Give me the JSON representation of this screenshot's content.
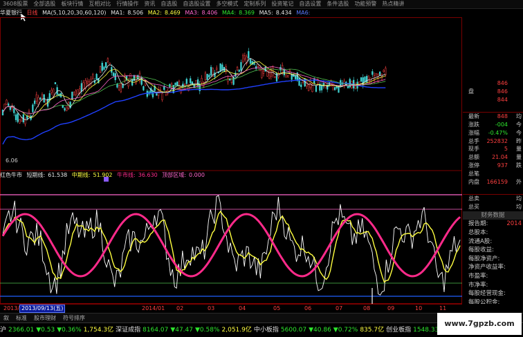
{
  "menubar": [
    "3608股票",
    "全部选股",
    "板块行情",
    "互相对比",
    "行情操作",
    "资讯",
    "自选股",
    "自选股设置",
    "多空模式",
    "定制系列",
    "投资笔记",
    "自选设置",
    "条件选股",
    "功能预警",
    "热点精讲"
  ],
  "kline_header": {
    "stock_name": "华夏银行",
    "period": "日线",
    "ma_params": "MA(5,10,20,30,60,120)",
    "ma1_label": "MA1:",
    "ma1_value": "8.506",
    "ma2_label": "MA2:",
    "ma2_value": "8.469",
    "ma3_label": "MA3:",
    "ma3_value": "8.406",
    "ma4_label": "MA4:",
    "ma4_value": "8.369",
    "ma5_label": "MA5:",
    "ma5_value": "8.434",
    "ma6_label": "MA6:"
  },
  "price_label_low": "6.06",
  "indicator_header": {
    "name": "红色牛市",
    "short_label": "短期线:",
    "short_value": "61.538",
    "mid_label": "中期线:",
    "mid_value": "51.902",
    "bull_label": "牛市线:",
    "bull_value": "36.630",
    "bottom_label": "顶部区域:",
    "bottom_value": "0.000"
  },
  "right_panel": {
    "quote_rows": [
      {
        "label": "",
        "value": "846",
        "ext": ""
      },
      {
        "label": "盘",
        "value": "846",
        "ext": ""
      },
      {
        "label": "",
        "value": "844",
        "ext": ""
      },
      {
        "label": "",
        "value": "",
        "ext": ""
      },
      {
        "label": "最新",
        "value": "848",
        "ext": "均"
      },
      {
        "label": "涨跌",
        "value": "-004",
        "ext": "今"
      },
      {
        "label": "涨幅",
        "value": "-0.47%",
        "ext": "今"
      },
      {
        "label": "总手",
        "value": "252832",
        "ext": "昨"
      },
      {
        "label": "现手",
        "value": "5",
        "ext": "量"
      },
      {
        "label": "总额",
        "value": "21.04",
        "ext": "量"
      },
      {
        "label": "涨停",
        "value": "937",
        "ext": "跌"
      },
      {
        "label": "总笔",
        "value": "",
        "ext": ""
      },
      {
        "label": "内盘",
        "value": "166159",
        "ext": "外"
      },
      {
        "label": "",
        "value": "",
        "ext": ""
      },
      {
        "label": "总卖",
        "value": "",
        "ext": "均"
      },
      {
        "label": "总买",
        "value": "",
        "ext": "均"
      }
    ],
    "fin_title": "财务数据",
    "fin_rows": [
      {
        "label": "报告期:",
        "value": "2014"
      },
      {
        "label": "总股本:",
        "value": ""
      },
      {
        "label": "流通A股:",
        "value": ""
      },
      {
        "label": "每股收益:",
        "value": ""
      },
      {
        "label": "每股净资产:",
        "value": ""
      },
      {
        "label": "净资产收益率:",
        "value": ""
      },
      {
        "label": "市盈率:",
        "value": ""
      },
      {
        "label": "市净率:",
        "value": ""
      },
      {
        "label": "每股经营现金:",
        "value": ""
      },
      {
        "label": "每股公积金:",
        "value": ""
      },
      {
        "label": "每股未分利:",
        "value": ""
      }
    ]
  },
  "time_axis": {
    "labels": [
      "2013/",
      "2014/01",
      "02",
      "03",
      "04",
      "05",
      "06",
      "07",
      "08",
      "09",
      "10",
      "11"
    ],
    "date_box": "2013/09/13(五)"
  },
  "bottom_tabs": [
    "叙",
    "标准",
    "股市理财",
    "符号排序"
  ],
  "ticker": [
    {
      "text": "沪",
      "color": "#e0e0e0"
    },
    {
      "text": "2366.01",
      "color": "#2ee82e"
    },
    {
      "text": "▼0.53",
      "color": "#2ee82e"
    },
    {
      "text": "▼0.36%",
      "color": "#2ee82e"
    },
    {
      "text": "1,754.3亿",
      "color": "#ffff40"
    },
    {
      "text": "深证成指",
      "color": "#e0e0e0"
    },
    {
      "text": "8164.07",
      "color": "#2ee82e"
    },
    {
      "text": "▼47.47",
      "color": "#2ee82e"
    },
    {
      "text": "▼0.58%",
      "color": "#2ee82e"
    },
    {
      "text": "2,051.9亿",
      "color": "#ffff40"
    },
    {
      "text": "中小板指",
      "color": "#e0e0e0"
    },
    {
      "text": "5600.07",
      "color": "#2ee82e"
    },
    {
      "text": "▼40.86",
      "color": "#2ee82e"
    },
    {
      "text": "▼0.72%",
      "color": "#2ee82e"
    },
    {
      "text": "835.7亿",
      "color": "#ffff40"
    },
    {
      "text": "创业板指",
      "color": "#e0e0e0"
    },
    {
      "text": "1548.33",
      "color": "#2ee82e"
    },
    {
      "text": "▼5.96",
      "color": "#2ee82e"
    },
    {
      "text": "405.8",
      "color": "#ffff40"
    }
  ],
  "watermark": "www.7gpzb.com",
  "colors": {
    "up": "#ff4040",
    "down": "#3fd0d0",
    "short_line": "#ffffff",
    "mid_line": "#ffff40",
    "bull_line": "#ff2a8a",
    "ma_blue": "#2040ff",
    "top_zone": "#ff66cc",
    "bottom_zone": "#2060ff"
  }
}
